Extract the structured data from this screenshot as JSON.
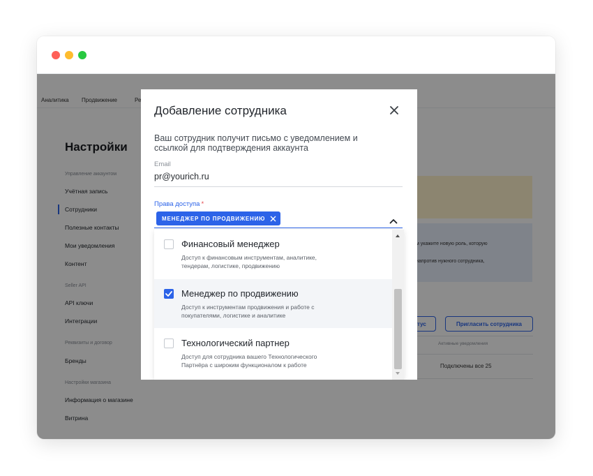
{
  "topnav": {
    "items": [
      "Аналитика",
      "Продвижение",
      "Ре"
    ]
  },
  "sidebar": {
    "title": "Настройки",
    "groups": [
      {
        "label": "Управление аккаунтом",
        "items": [
          "Учётная запись",
          "Сотрудники",
          "Полезные контакты",
          "Мои уведомления",
          "Контент"
        ]
      },
      {
        "label": "Seller API",
        "items": [
          "API ключи",
          "Интеграции"
        ]
      },
      {
        "label": "Реквизиты и договор",
        "items": [
          "Бренды"
        ]
      },
      {
        "label": "Настройки магазина",
        "items": [
          "Информация о магазине",
          "Витрина"
        ]
      }
    ],
    "active_item": "Сотрудники"
  },
  "main": {
    "banner_text": [
      "м укажите новую роль, которую",
      "напротив нужного сотрудника,"
    ],
    "status_button_label": "тус",
    "invite_button_label": "Пригласить сотрудника",
    "table_header_notifications": "Активные уведомления",
    "table_row_notifications": "Подключены все 25"
  },
  "modal": {
    "title": "Добавление сотрудника",
    "description_lines": [
      "Ваш сотрудник получит письмо с уведомлением и",
      "ссылкой для подтверждения аккаунта"
    ],
    "email_label": "Email",
    "email_value": "pr@yourich.ru",
    "rights_label": "Права доступа",
    "required_mark": "*",
    "selected_chip": "МЕНЕДЖЕР ПО ПРОДВИЖЕНИЮ",
    "options": [
      {
        "title": "Финансовый менеджер",
        "desc": [
          "Доступ к финансовым инструментам, аналитике,",
          "тендерам, логистике, продвижению"
        ],
        "checked": false
      },
      {
        "title": "Менеджер по продвижению",
        "desc": [
          "Доступ к инструментам продвижения и работе с",
          "покупателями, логистике и аналитике"
        ],
        "checked": true
      },
      {
        "title": "Технологический партнер",
        "desc": [
          "Доступ для сотрудника вашего Технологического",
          "Партнёра с широким функционалом к работе"
        ],
        "checked": false
      }
    ]
  },
  "colors": {
    "accent": "#2c63e8",
    "required": "#e5484d",
    "traffic_red": "#fe5f57",
    "traffic_yellow": "#febc2e",
    "traffic_green": "#28c840"
  },
  "icons": {
    "close": "close-icon",
    "chip_remove": "chip-remove-icon",
    "caret": "chevron-up-icon",
    "check": "checkmark-icon"
  }
}
